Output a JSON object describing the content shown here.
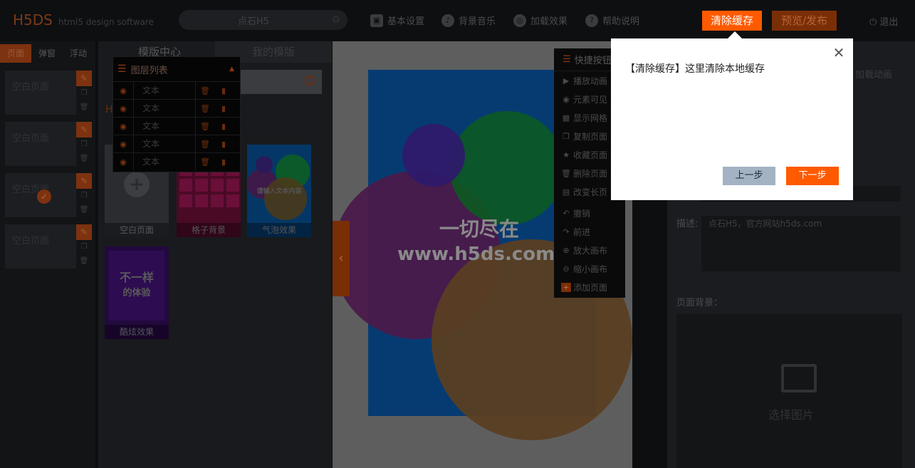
{
  "app": {
    "logo": "H5DS",
    "logo_sub": "html5 design software",
    "project_name": "点石H5"
  },
  "topmenu": {
    "basic_settings": "基本设置",
    "bg_music": "背景音乐",
    "load_effect": "加载效果",
    "help": "帮助说明",
    "clear_cache": "清除缓存",
    "preview_publish": "预览/发布",
    "logout": "退出"
  },
  "left_tabs": [
    "页面",
    "弹窗",
    "浮动"
  ],
  "pages": [
    {
      "label": "空白页面"
    },
    {
      "label": "空白页面"
    },
    {
      "label": "空白页面"
    },
    {
      "label": "空白页面"
    }
  ],
  "templates": {
    "tab_center": "模版中心",
    "tab_mine": "我的模版",
    "cards": [
      {
        "label": "空白页面"
      },
      {
        "label": "格子背景"
      },
      {
        "label": "气泡效果",
        "inner_text": "请输入文本内容"
      },
      {
        "label": "酷炫效果",
        "inner_line1": "不一样",
        "inner_line2": "的体验"
      }
    ]
  },
  "layers": {
    "title": "图层列表",
    "rows": [
      "文本",
      "文本",
      "文本",
      "文本",
      "文本"
    ]
  },
  "canvas": {
    "text_line1": "一切尽在",
    "text_line2": "www.h5ds.com"
  },
  "shortcuts": {
    "title": "快捷按钮",
    "items": [
      "播放动画",
      "元素可见",
      "显示网格",
      "复制页面",
      "收藏页面",
      "删除页面",
      "改变长页",
      "撤销",
      "前进",
      "放大画布",
      "缩小画布",
      "添加页面"
    ]
  },
  "right_panel": {
    "load_anim": "加载动画",
    "desc_label": "描述:",
    "desc_value": "点石H5，官方网站h5ds.com",
    "bg_label": "页面背景：",
    "choose_image": "选择图片"
  },
  "dialog": {
    "message": "【清除缓存】这里清除本地缓存",
    "prev": "上一步",
    "next": "下一步"
  }
}
